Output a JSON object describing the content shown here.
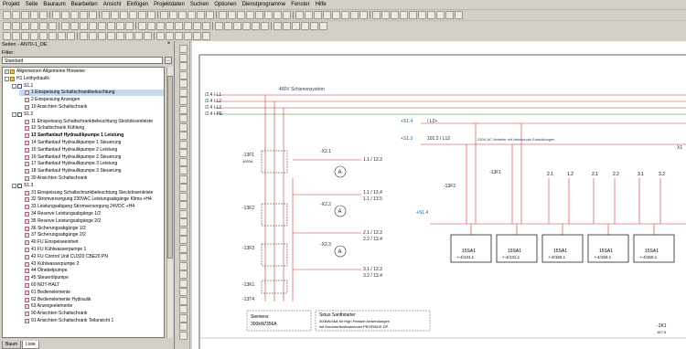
{
  "menu": [
    "Projekt",
    "Seite",
    "Bauraum",
    "Bearbeiten",
    "Ansicht",
    "Einfügen",
    "Projektdaten",
    "Suchen",
    "Optionen",
    "Dienstprogramme",
    "Fenster",
    "Hilfe"
  ],
  "toolbar": {
    "zoom_value": "",
    "layer_value": ""
  },
  "panel": {
    "title": "Seiten - AN70-1_DE",
    "close": "×",
    "filter_label": "Filter:",
    "filter_value": "Standard",
    "filter_button": "…",
    "tabs": [
      {
        "label": "Baum"
      },
      {
        "label": "Liste"
      }
    ],
    "tree": [
      {
        "label": "Allgemeinen Allgemeine Hinweise",
        "level": 0,
        "icon": "folder",
        "exp": "+"
      },
      {
        "label": "H1 Leithydraulik",
        "level": 0,
        "icon": "folder",
        "exp": "-"
      },
      {
        "label": "S1.1",
        "level": 1,
        "icon": "func",
        "exp": "-"
      },
      {
        "label": "1 Einspeisung Schaltschrankbeleuchtung",
        "level": 2,
        "icon": "page",
        "selected": true
      },
      {
        "label": "2 Einspeisung Anzeigen",
        "level": 2,
        "icon": "page"
      },
      {
        "label": "10 Ansichten Schaltschrank",
        "level": 2,
        "icon": "page"
      },
      {
        "label": "S1.2",
        "level": 1,
        "icon": "func",
        "exp": "-"
      },
      {
        "label": "11 Einspeisung Schaltschrankbeleuchtung Steckdosenleiste",
        "level": 2,
        "icon": "page"
      },
      {
        "label": "12 Schaltschrank Kühlung",
        "level": 2,
        "icon": "page"
      },
      {
        "label": "13 Sanftanlauf Hydraulikpumpe 1 Leistung",
        "level": 2,
        "icon": "page",
        "bold": true
      },
      {
        "label": "14 Sanftanlauf Hydraulikpumpe 1 Steuerung",
        "level": 2,
        "icon": "page"
      },
      {
        "label": "15 Sanftanlauf Hydraulikpumpe 2 Leistung",
        "level": 2,
        "icon": "page"
      },
      {
        "label": "16 Sanftanlauf Hydraulikpumpe 2 Steuerung",
        "level": 2,
        "icon": "page"
      },
      {
        "label": "17 Sanftanlauf Hydraulikpumpe 3 Leistung",
        "level": 2,
        "icon": "page"
      },
      {
        "label": "18 Sanftanlauf Hydraulikpumpe 3 Steuerung",
        "level": 2,
        "icon": "page"
      },
      {
        "label": "30 Ansichten Schaltschrank",
        "level": 2,
        "icon": "page"
      },
      {
        "label": "S1.3",
        "level": 1,
        "icon": "func",
        "exp": "-"
      },
      {
        "label": "31 Einspeisung Schaltschrankbeleuchtung Steckdosenleiste",
        "level": 2,
        "icon": "page"
      },
      {
        "label": "32 Stromversorgung 230VAC Leistungsabgänge Klima +H4",
        "level": 2,
        "icon": "page"
      },
      {
        "label": "33 Leistungsabgang Stromversorgung 24VDC +H4",
        "level": 2,
        "icon": "page"
      },
      {
        "label": "34 Reserve Leistungsabgänge 1/2",
        "level": 2,
        "icon": "page"
      },
      {
        "label": "35 Reserve Leistungsabgänge 2/2",
        "level": 2,
        "icon": "page"
      },
      {
        "label": "36 Sicherungsabgänge 1/2",
        "level": 2,
        "icon": "page"
      },
      {
        "label": "37 Sicherungsabgänge 2/2",
        "level": 2,
        "icon": "page"
      },
      {
        "label": "40 FU Einspeiseeinheit",
        "level": 2,
        "icon": "page"
      },
      {
        "label": "41 FU Kühlwasserpumpe 1",
        "level": 2,
        "icon": "page"
      },
      {
        "label": "42 FU Control Unit CU320 CBE20 PN",
        "level": 2,
        "icon": "page"
      },
      {
        "label": "43 Kühlwasserpumpe 2",
        "level": 2,
        "icon": "page"
      },
      {
        "label": "44 Ölnebelpumpe",
        "level": 2,
        "icon": "page"
      },
      {
        "label": "45 Steuerölpumpe",
        "level": 2,
        "icon": "page"
      },
      {
        "label": "60 NOT-HALT",
        "level": 2,
        "icon": "page"
      },
      {
        "label": "61 Bedienelemente",
        "level": 2,
        "icon": "page"
      },
      {
        "label": "62 Bedienelemente Hydraulik",
        "level": 2,
        "icon": "page"
      },
      {
        "label": "63 Anzeigeelemente",
        "level": 2,
        "icon": "page"
      },
      {
        "label": "90 Ansichten Schaltschrank",
        "level": 2,
        "icon": "page"
      },
      {
        "label": "91 Ansichten Schaltschrank Teilansicht 1",
        "level": 2,
        "icon": "page"
      }
    ]
  },
  "schematic": {
    "supply_labels": [
      "/2.4 / L1",
      "/2.4 / L2",
      "/2.4 / L3",
      "/2.4 / PE"
    ],
    "bus_note": "400V Schienensystem",
    "ctrl_inputs": [
      "+S1.4",
      "+S1.3"
    ],
    "ctrl_tags": [
      "/ L2+",
      "101.2 / L12"
    ],
    "ctrl_note": "230V AC Verteiler mit Netzschutz Einrichtungen",
    "x1_label": "X1",
    "x4_label": "+S1.4",
    "comp_13F1": "-13F1",
    "comp_13F2": "-13F2",
    "comp_13F3": "-13F3",
    "comp_13K1": "-13K1",
    "comp_13T4": "-13T4",
    "breaker_tags": [
      "-X2.1",
      "-X2.2",
      "-X2.3"
    ],
    "meter_symbol": "A",
    "out_tags": [
      "1.1 / 13.3",
      "1.1 / 13.4",
      "1.1 / 13.5",
      "2.1 / 13.3",
      "2.2 / 13.4",
      "3.1 / 13.3",
      "3.2 / 13.4"
    ],
    "maker_left": "Siemens",
    "maker_left_sub": "300kW/356A",
    "maker_right": "Sirius Sanftstarter",
    "maker_right_sub": "300kW/46A für High Feature Anwendungen",
    "maker_right_sub2": "mit Kommunikationsmodul PROFIBUS DP",
    "relay_tags": [
      "-13F1",
      "-13F2"
    ],
    "card_id": [
      "15SA1",
      "15SA1",
      "15SA1",
      "15SA1",
      "15SA1"
    ],
    "card_ref": [
      "+-4/131.1",
      "+-4/131.1",
      "+-4/150.1",
      "+-4/150.1",
      "+-4/150.1"
    ],
    "col_tags": [
      "2.1",
      "1.2",
      "2.1",
      "2.2",
      "3.1",
      "3.2"
    ],
    "bottom_tag": "-1K1",
    "bottom_tag2": "JK7.5"
  }
}
